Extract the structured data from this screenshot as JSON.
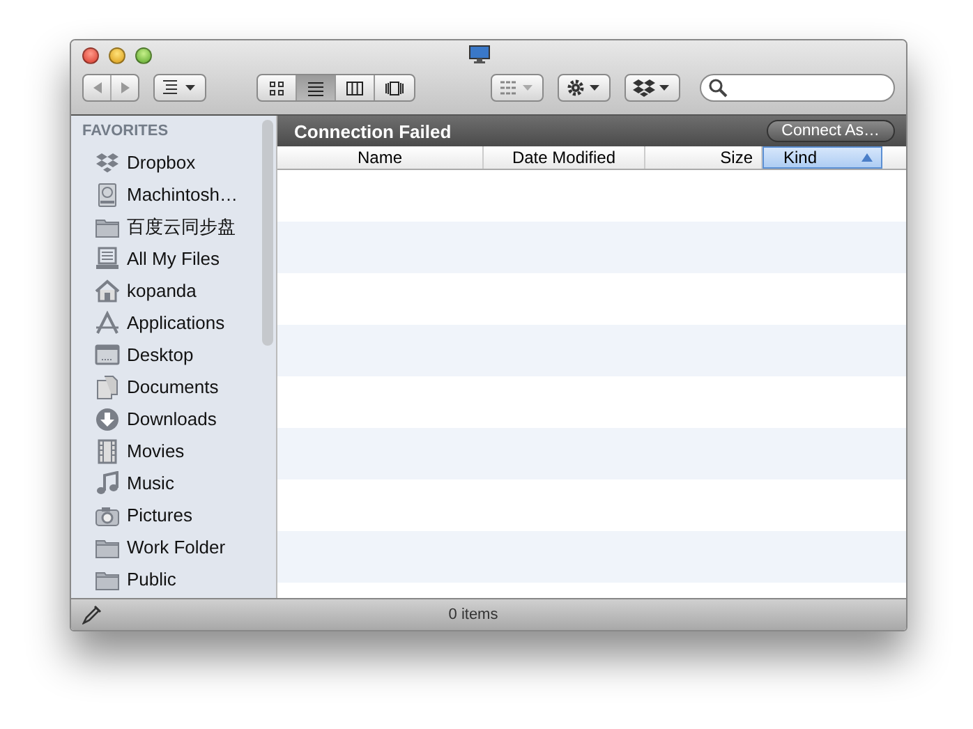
{
  "toolbar": {
    "view_modes": [
      {
        "kind": "icons",
        "selected": false
      },
      {
        "kind": "list",
        "selected": true
      },
      {
        "kind": "columns",
        "selected": false
      },
      {
        "kind": "coverflow",
        "selected": false
      }
    ]
  },
  "sidebar": {
    "heading": "FAVORITES",
    "items": [
      {
        "label": "Dropbox",
        "kind": "dropbox"
      },
      {
        "label": "Machintosh…",
        "kind": "disk"
      },
      {
        "label": "百度云同步盘",
        "kind": "folder"
      },
      {
        "label": "All My Files",
        "kind": "files"
      },
      {
        "label": "kopanda",
        "kind": "home"
      },
      {
        "label": "Applications",
        "kind": "apps"
      },
      {
        "label": "Desktop",
        "kind": "desktop"
      },
      {
        "label": "Documents",
        "kind": "docs"
      },
      {
        "label": "Downloads",
        "kind": "downloads"
      },
      {
        "label": "Movies",
        "kind": "movies"
      },
      {
        "label": "Music",
        "kind": "music"
      },
      {
        "label": "Pictures",
        "kind": "pictures"
      },
      {
        "label": "Work Folder",
        "kind": "folder"
      },
      {
        "label": "Public",
        "kind": "folder"
      }
    ]
  },
  "path_bar": {
    "title": "Connection Failed",
    "button": "Connect As…"
  },
  "table": {
    "columns": [
      {
        "label": "Name",
        "selected": false
      },
      {
        "label": "Date Modified",
        "selected": false
      },
      {
        "label": "Size",
        "selected": false
      },
      {
        "label": "Kind",
        "selected": true
      }
    ]
  },
  "status_bar": {
    "text": "0 items"
  }
}
